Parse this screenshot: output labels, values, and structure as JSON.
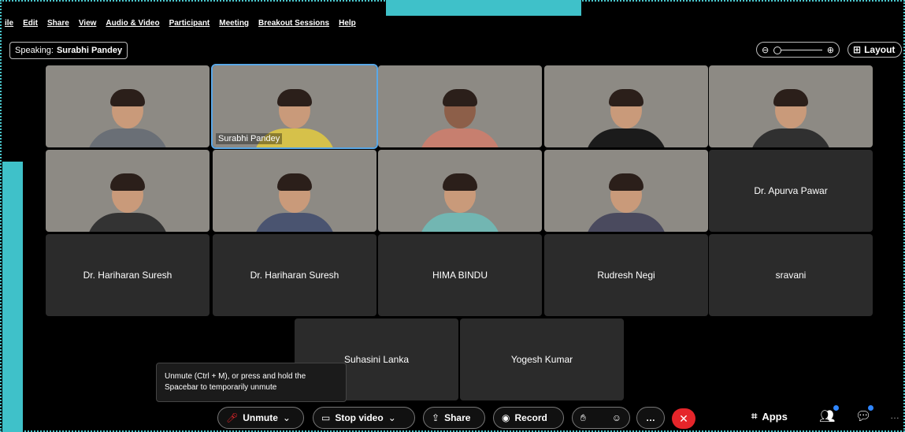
{
  "menu": {
    "items": [
      "ile",
      "Edit",
      "Share",
      "View",
      "Audio & Video",
      "Participant",
      "Meeting",
      "Breakout Sessions",
      "Help"
    ]
  },
  "speaking": {
    "label": "Speaking:",
    "name": "Surabhi Pandey"
  },
  "zoom": {
    "out_icon": "zoom-out-icon",
    "in_icon": "zoom-in-icon"
  },
  "layout": {
    "label": "Layout",
    "icon": "grid-layout-icon"
  },
  "tiles": {
    "r2c1": "Dr. Apurva Pawar",
    "r3c1": "Dr. Hariharan Suresh",
    "r3c2": "Dr. Hariharan Suresh",
    "r3c3": "HIMA BINDU",
    "r3c4": "Rudresh Negi",
    "r3c5": "sravani",
    "r4c1": "Suhasini Lanka",
    "r4c2": "Yogesh Kumar",
    "active_video_name": "Surabhi Pandey"
  },
  "tooltip": {
    "text": "Unmute (Ctrl + M), or press and hold the Spacebar to temporarily unmute"
  },
  "toolbar": {
    "unmute": "Unmute",
    "stop_video": "Stop video",
    "share": "Share",
    "record": "Record",
    "apps": "Apps",
    "more": "…"
  },
  "colors": {
    "accent_frame": "#3fc1c9",
    "active_border": "#5aa7e6",
    "end_call": "#e5252a",
    "badge": "#2f86ff"
  }
}
